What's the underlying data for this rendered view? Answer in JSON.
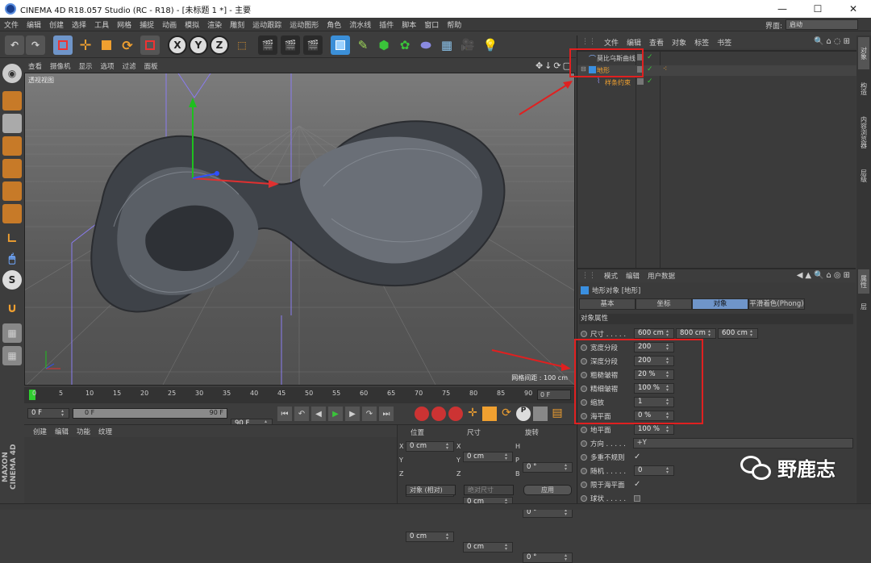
{
  "window": {
    "title": "CINEMA 4D R18.057 Studio (RC - R18) - [未标题 1 *] - 主要",
    "min_glyph": "—",
    "max_glyph": "☐",
    "close_glyph": "✕"
  },
  "menu": [
    "文件",
    "编辑",
    "创建",
    "选择",
    "工具",
    "网格",
    "捕捉",
    "动画",
    "模拟",
    "渲染",
    "雕刻",
    "运动跟踪",
    "运动图形",
    "角色",
    "流水线",
    "插件",
    "脚本",
    "窗口",
    "帮助"
  ],
  "layout": {
    "label": "界面:",
    "value": "启动"
  },
  "toolbar": {
    "axis_x": "X",
    "axis_y": "Y",
    "axis_z": "Z"
  },
  "viewport": {
    "menu": [
      "查看",
      "摄像机",
      "显示",
      "选项",
      "过滤",
      "面板"
    ],
    "label": "透视视图",
    "grid_spacing": "网格间距 : 100 cm"
  },
  "timeline": {
    "ticks": [
      "0",
      "5",
      "10",
      "15",
      "20",
      "25",
      "30",
      "35",
      "40",
      "45",
      "50",
      "55",
      "60",
      "65",
      "70",
      "75",
      "80",
      "85",
      "90"
    ],
    "current_frame": "0 F",
    "start": "0 F",
    "range_start": "0 F",
    "range_end": "90 F",
    "end": "90 F"
  },
  "material_manager": {
    "menu": [
      "创建",
      "编辑",
      "功能",
      "纹理"
    ]
  },
  "coords": {
    "headers": [
      "位置",
      "尺寸",
      "旋转"
    ],
    "rows": [
      {
        "pl": "X",
        "pv": "0 cm",
        "sl": "X",
        "sv": "0 cm",
        "rl": "H",
        "rv": "0 °"
      },
      {
        "pl": "Y",
        "pv": "0 cm",
        "sl": "Y",
        "sv": "0 cm",
        "rl": "P",
        "rv": "0 °"
      },
      {
        "pl": "Z",
        "pv": "0 cm",
        "sl": "Z",
        "sv": "0 cm",
        "rl": "B",
        "rv": "0 °"
      }
    ],
    "mode": "对象 (相对)",
    "size_mode": "绝对尺寸",
    "apply": "应用"
  },
  "object_manager": {
    "menu": [
      "文件",
      "编辑",
      "查看",
      "对象",
      "标签",
      "书签"
    ],
    "objects": [
      {
        "name": "莫比乌斯曲线",
        "color": "#d6d6d6"
      },
      {
        "name": "地形",
        "color": "#f0a030"
      },
      {
        "name": "样条约束",
        "color": "#f0a030"
      }
    ]
  },
  "attribute_manager": {
    "menu": [
      "模式",
      "编辑",
      "用户数据"
    ],
    "object_title": "地形对象 [地形]",
    "tabs": [
      "基本",
      "坐标",
      "对象",
      "平滑着色(Phong)"
    ],
    "active_tab": "对象",
    "section": "对象属性",
    "size_label": "尺寸 . . . . .",
    "size": [
      "600 cm",
      "800 cm",
      "600 cm"
    ],
    "fields": [
      {
        "label": "宽度分段",
        "value": "200"
      },
      {
        "label": "深度分段",
        "value": "200"
      },
      {
        "label": "粗糙皱褶",
        "value": "20 %"
      },
      {
        "label": "精细皱褶",
        "value": "100 %"
      },
      {
        "label": "缩放",
        "value": "1"
      },
      {
        "label": "海平面",
        "value": "0 %"
      },
      {
        "label": "地平面",
        "value": "100 %"
      }
    ],
    "direction_label": "方向 . . . . .",
    "direction": "+Y",
    "multi_label": "多重不规则",
    "multi_checked": "✓",
    "random_label": "随机 . . . . .",
    "random": "0",
    "limit_label": "限于海平面",
    "limit_checked": "✓",
    "sphere_label": "球状 . . . . ."
  },
  "side_tabs_top": [
    "对象",
    "构造",
    "内容浏览器",
    "层级"
  ],
  "side_tabs_bottom": [
    "属性",
    "层"
  ],
  "watermark": "野鹿志",
  "brand": "MAXON CINEMA 4D",
  "colors": {
    "accent_orange": "#f0a030",
    "highlight_blue": "#6f95c9",
    "annotation_red": "#e02020",
    "axis_green": "#1ec01e",
    "axis_red": "#e03030",
    "axis_blue": "#3050ff"
  }
}
